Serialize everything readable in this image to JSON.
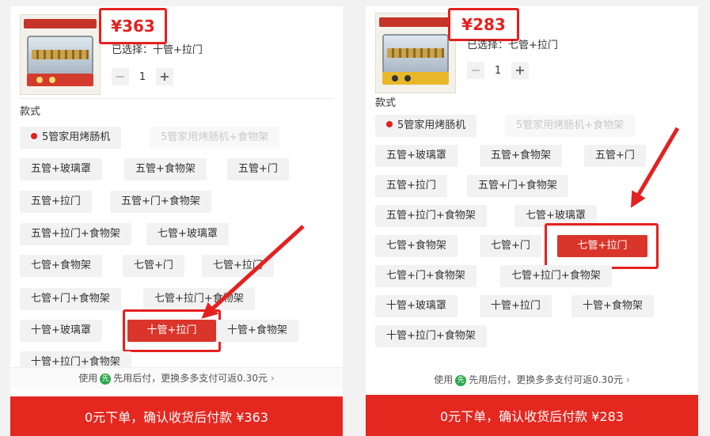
{
  "left": {
    "price": "¥363",
    "selected_text": "已选择：十管+拉门",
    "quantity": "1",
    "section_label": "款式",
    "options": [
      {
        "label": "5管家用烤肠机",
        "state": "default",
        "dot": true
      },
      {
        "label": "5管家用烤肠机+食物架",
        "state": "disabled"
      },
      {
        "label": "五管+玻璃罩",
        "state": "default"
      },
      {
        "label": "五管+食物架",
        "state": "default"
      },
      {
        "label": "五管+门",
        "state": "default"
      },
      {
        "label": "五管+拉门",
        "state": "default"
      },
      {
        "label": "五管+门+食物架",
        "state": "default"
      },
      {
        "label": "五管+拉门+食物架",
        "state": "default"
      },
      {
        "label": "七管+玻璃罩",
        "state": "default"
      },
      {
        "label": "七管+食物架",
        "state": "default"
      },
      {
        "label": "七管+门",
        "state": "default"
      },
      {
        "label": "七管+拉门",
        "state": "default"
      },
      {
        "label": "七管+门+食物架",
        "state": "default"
      },
      {
        "label": "七管+拉门+食物架",
        "state": "default"
      },
      {
        "label": "十管+玻璃罩",
        "state": "default"
      },
      {
        "label": "十管+拉门",
        "state": "active"
      },
      {
        "label": "十管+食物架",
        "state": "default"
      },
      {
        "label": "十管+拉门+食物架",
        "state": "default"
      }
    ],
    "pay_prefix": "使用",
    "pay_badge": "先",
    "pay_text": "先用后付，更换多多支付可返0.30元",
    "pay_chevron": "›",
    "cta": "0元下单，确认收货后付款 ¥363"
  },
  "right": {
    "price": "¥283",
    "selected_text": "已选择：七管+拉门",
    "quantity": "1",
    "section_label": "款式",
    "options": [
      {
        "label": "5管家用烤肠机",
        "state": "default",
        "dot": true
      },
      {
        "label": "5管家用烤肠机+食物架",
        "state": "disabled"
      },
      {
        "label": "五管+玻璃罩",
        "state": "default"
      },
      {
        "label": "五管+食物架",
        "state": "default"
      },
      {
        "label": "五管+门",
        "state": "default"
      },
      {
        "label": "五管+拉门",
        "state": "default"
      },
      {
        "label": "五管+门+食物架",
        "state": "default"
      },
      {
        "label": "五管+拉门+食物架",
        "state": "default"
      },
      {
        "label": "七管+玻璃罩",
        "state": "default"
      },
      {
        "label": "七管+食物架",
        "state": "default"
      },
      {
        "label": "七管+门",
        "state": "default"
      },
      {
        "label": "七管+拉门",
        "state": "active"
      },
      {
        "label": "七管+门+食物架",
        "state": "default"
      },
      {
        "label": "七管+拉门+食物架",
        "state": "default"
      },
      {
        "label": "十管+玻璃罩",
        "state": "default"
      },
      {
        "label": "十管+拉门",
        "state": "default"
      },
      {
        "label": "十管+食物架",
        "state": "default"
      },
      {
        "label": "十管+拉门+食物架",
        "state": "default"
      }
    ],
    "pay_prefix": "使用",
    "pay_badge": "先",
    "pay_text": "先用后付，更换多多支付可返0.30元",
    "pay_chevron": "›",
    "cta": "0元下单，确认收货后付款 ¥283"
  },
  "stepper": {
    "minus": "−",
    "plus": "+"
  },
  "colors": {
    "accent": "#e4211f",
    "active_bg": "#d9352a",
    "chip_bg": "#f2f2f2"
  },
  "icons": {
    "dot": "red-dot-icon",
    "badge": "pay-later-badge-icon",
    "chevron": "chevron-right-icon"
  }
}
